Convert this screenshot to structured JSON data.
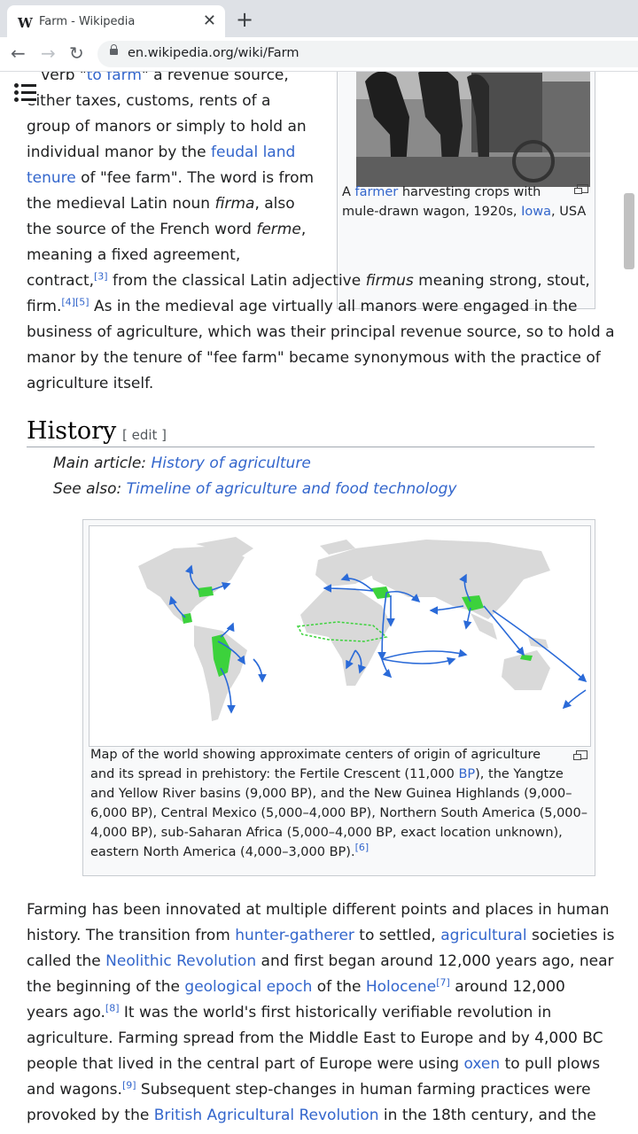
{
  "browser": {
    "tab_title": "Farm - Wikipedia",
    "tab_favicon": "W",
    "close_glyph": "✕",
    "new_tab_glyph": "+",
    "back_glyph": "←",
    "forward_glyph": "→",
    "reload_glyph": "↻",
    "url": "en.wikipedia.org/wiki/Farm"
  },
  "etymology": {
    "line0": {
      "a": "verb \"",
      "b": "to farm",
      "c": "\" a revenue source,"
    },
    "line1": "either taxes, customs, rents of a",
    "line2": "group of manors or simply to hold an",
    "line3": {
      "a": "individual manor by the ",
      "b": "feudal land"
    },
    "line4": {
      "a": "tenure",
      "b": " of \"fee farm\". The word is from"
    },
    "line5": {
      "a": "the medieval Latin noun ",
      "b": "firma",
      "c": ", also"
    },
    "line6": {
      "a": "the source of the French word ",
      "b": "ferme",
      "c": ","
    },
    "line7": "meaning a fixed agreement,",
    "line8": {
      "a": "contract,",
      "ref": "[3]",
      "b": " from the classical Latin adjective ",
      "c": "firmus",
      "d": " meaning strong, stout,"
    },
    "line9": {
      "a": "firm.",
      "ref1": "[4]",
      "ref2": "[5]",
      "b": " As in the medieval age virtually all manors were engaged in the"
    },
    "line10": "business of agriculture, which was their principal revenue source, so to hold a",
    "line11": "manor by the tenure of \"fee farm\" became synonymous with the practice of",
    "line12": "agriculture itself."
  },
  "figure1": {
    "caption": {
      "a": "A ",
      "b": "farmer",
      "c": " harvesting crops with",
      "d": "mule-drawn wagon, 1920s, ",
      "e": "Iowa",
      "f": ", USA"
    }
  },
  "history": {
    "heading": "History",
    "edit_label": "[ edit ]",
    "main_article_prefix": "Main article: ",
    "main_article_link": "History of agriculture",
    "see_also_prefix": "See also: ",
    "see_also_link": "Timeline of agriculture and food technology"
  },
  "figure2": {
    "cap1": "Map of the world showing approximate centers of origin of agriculture",
    "cap2": {
      "a": "and its spread in prehistory: the Fertile Crescent (11,000 ",
      "b": "BP",
      "c": "), the Yangtze"
    },
    "cap3": "and Yellow River basins (9,000 BP), and the New Guinea Highlands (9,000–",
    "cap4": "6,000 BP), Central Mexico (5,000–4,000 BP), Northern South America (5,000–",
    "cap5": "4,000 BP), sub-Saharan Africa (5,000–4,000 BP, exact location unknown),",
    "cap6": {
      "a": "eastern North America (4,000–3,000 BP).",
      "ref": "[6]"
    }
  },
  "para2": {
    "l1": "Farming has been innovated at multiple different points and places in human",
    "l2": {
      "a": "history. The transition from ",
      "b": "hunter-gatherer",
      "c": " to settled, ",
      "d": "agricultural",
      "e": " societies is"
    },
    "l3": {
      "a": "called the ",
      "b": "Neolithic Revolution",
      "c": " and first began around 12,000 years ago, near"
    },
    "l4": {
      "a": "the beginning of the ",
      "b": "geological epoch",
      "c": " of the ",
      "d": "Holocene",
      "ref": "[7]",
      "e": " around 12,000"
    },
    "l5": {
      "a": "years ago.",
      "ref": "[8]",
      "b": " It was the world's first historically verifiable revolution in"
    },
    "l6": "agriculture. Farming spread from the Middle East to Europe and by 4,000 BC",
    "l7": {
      "a": "people that lived in the central part of Europe were using ",
      "b": "oxen",
      "c": " to pull plows"
    },
    "l8": {
      "a": "and wagons.",
      "ref": "[9]",
      "b": " Subsequent step-changes in human farming practices were"
    },
    "l9": {
      "a": "provoked by the ",
      "b": "British Agricultural Revolution",
      "c": " in the 18th century, and the"
    }
  },
  "colors": {
    "link": "#3366cc",
    "origin_green": "#3cd23c",
    "arrow_blue": "#2a6ad8",
    "land_gray": "#d9d9d9"
  }
}
